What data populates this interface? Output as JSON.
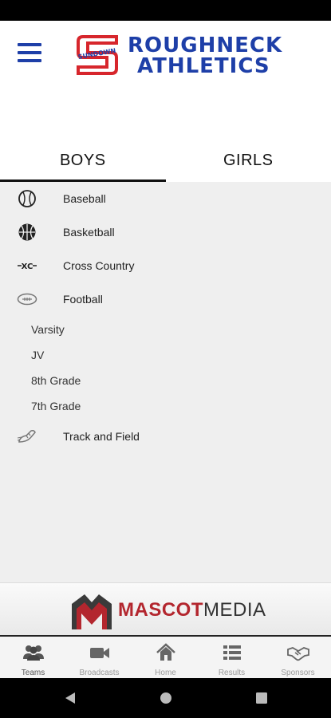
{
  "header": {
    "logo_text_line1": "ROUGHNECK",
    "logo_text_line2": "ATHLETICS",
    "logo_badge_text": "SUNDOWN",
    "brand_blue": "#1e3fa8",
    "brand_red": "#d7262c"
  },
  "tabs": [
    {
      "label": "BOYS",
      "selected": true
    },
    {
      "label": "GIRLS",
      "selected": false
    }
  ],
  "sports": [
    {
      "label": "Baseball",
      "icon": "baseball-icon"
    },
    {
      "label": "Basketball",
      "icon": "basketball-icon"
    },
    {
      "label": "Cross Country",
      "icon": "cross-country-icon",
      "icon_text": "XC"
    },
    {
      "label": "Football",
      "icon": "football-icon",
      "expanded": true,
      "subitems": [
        "Varsity",
        "JV",
        "8th Grade",
        "7th Grade"
      ]
    },
    {
      "label": "Track and Field",
      "icon": "track-shoe-icon"
    }
  ],
  "sponsor": {
    "word1": "MASCOT",
    "word2": "MEDIA",
    "red": "#b3262e"
  },
  "bottom_nav": [
    {
      "label": "Teams",
      "icon": "teams-icon",
      "active": true
    },
    {
      "label": "Broadcasts",
      "icon": "video-camera-icon",
      "active": false
    },
    {
      "label": "Home",
      "icon": "home-icon",
      "active": false
    },
    {
      "label": "Results",
      "icon": "list-icon",
      "active": false
    },
    {
      "label": "Sponsors",
      "icon": "handshake-icon",
      "active": false
    }
  ]
}
